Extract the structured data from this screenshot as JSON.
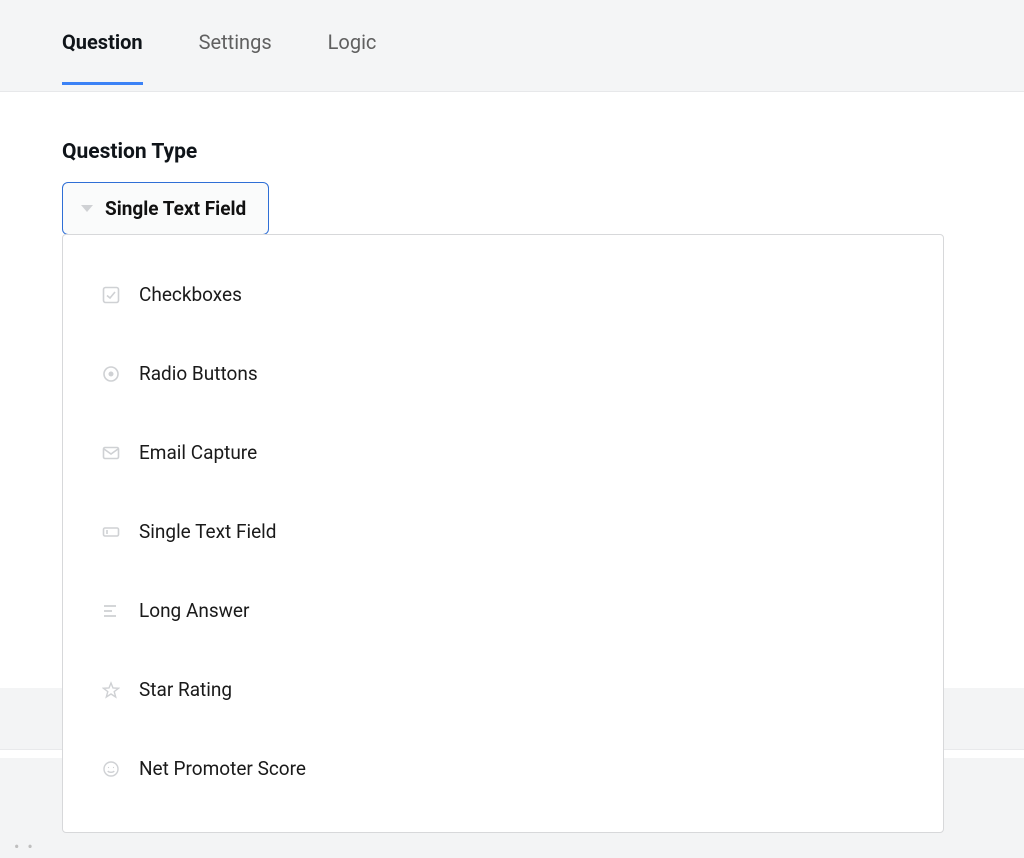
{
  "tabs": [
    {
      "label": "Question",
      "active": true
    },
    {
      "label": "Settings",
      "active": false
    },
    {
      "label": "Logic",
      "active": false
    }
  ],
  "section_title": "Question Type",
  "dropdown": {
    "selected_label": "Single Text Field",
    "options": [
      {
        "icon": "checkbox",
        "label": "Checkboxes"
      },
      {
        "icon": "radio",
        "label": "Radio Buttons"
      },
      {
        "icon": "email",
        "label": "Email Capture"
      },
      {
        "icon": "textfield",
        "label": "Single Text Field"
      },
      {
        "icon": "longanswer",
        "label": "Long Answer"
      },
      {
        "icon": "star",
        "label": "Star Rating"
      },
      {
        "icon": "smiley",
        "label": "Net Promoter Score"
      }
    ]
  }
}
